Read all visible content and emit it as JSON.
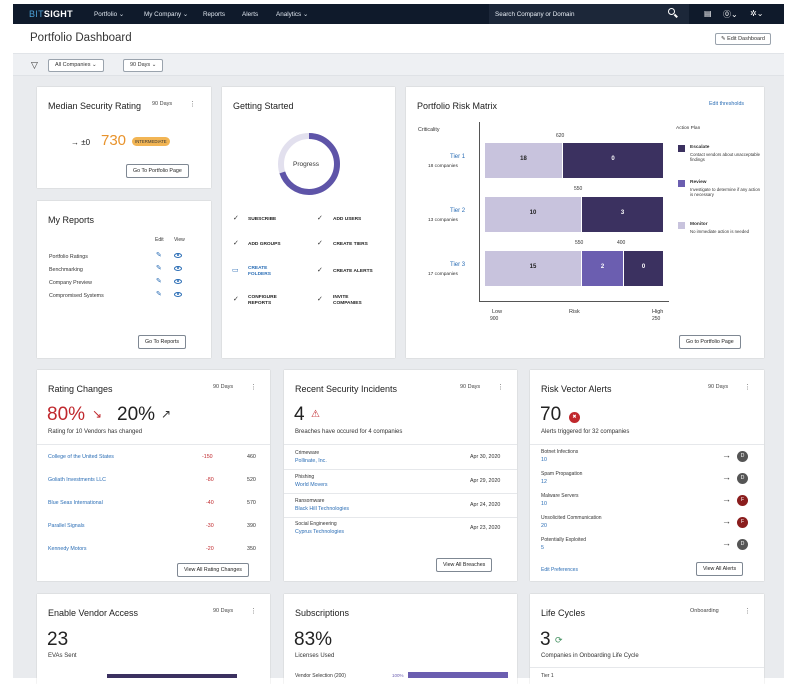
{
  "nav": {
    "logo_a": "BIT",
    "logo_b": "SIGHT",
    "items": [
      "Portfolio ⌄",
      "My Company ⌄",
      "Reports",
      "Alerts",
      "Analytics ⌄"
    ],
    "search": "Search Company or Domain"
  },
  "header": {
    "title": "Portfolio Dashboard",
    "edit": "Edit Dashboard"
  },
  "filters": {
    "companies": "All Companies ⌄",
    "days": "90 Days ⌄"
  },
  "median": {
    "title": "Median Security Rating",
    "days": "90 Days",
    "delta": "→ ±0",
    "value": "730",
    "badge": "INTERMEDIATE",
    "button": "Go To Portfolio Page"
  },
  "reports": {
    "title": "My Reports",
    "edit": "Edit",
    "view": "View",
    "items": [
      "Portfolio Ratings",
      "Benchmarking",
      "Company Preview",
      "Compromised Systems"
    ],
    "button": "Go To Reports"
  },
  "getting": {
    "title": "Getting Started",
    "progress": "Progress",
    "progress_pct": 70,
    "items": [
      [
        "SUBSCRIBE",
        "ADD USERS"
      ],
      [
        "ADD GROUPS",
        "CREATE TIERS"
      ],
      [
        "CREATE FOLDERS",
        "CREATE ALERTS"
      ],
      [
        "CONFIGURE REPORTS",
        "INVITE COMPANIES"
      ]
    ]
  },
  "risk": {
    "title": "Portfolio Risk Matrix",
    "edit": "Edit thresholds",
    "criticality": "Criticality",
    "action_plan": "Action Plan",
    "tiers": [
      {
        "name": "Tier 1",
        "sub": "18 companies"
      },
      {
        "name": "Tier 2",
        "sub": "13 companies"
      },
      {
        "name": "Tier 3",
        "sub": "17 companies"
      }
    ],
    "thresholds": [
      "620",
      "550",
      "550",
      "400"
    ],
    "low": "Low",
    "low_val": "900",
    "risk": "Risk",
    "high": "High",
    "high_val": "250",
    "legend": [
      {
        "t": "Escalate",
        "d": "Contact vendors about unacceptable findings"
      },
      {
        "t": "Review",
        "d": "Investigate to determine if any action is necessary"
      },
      {
        "t": "Monitor",
        "d": "No immediate action is needed"
      }
    ],
    "button": "Go to Portfolio Page"
  },
  "chart_data": {
    "type": "bar",
    "categories": [
      "Tier 1",
      "Tier 2",
      "Tier 3"
    ],
    "series": [
      {
        "name": "Monitor",
        "values": [
          18,
          10,
          15
        ]
      },
      {
        "name": "Review",
        "values": [
          0,
          0,
          2
        ]
      },
      {
        "name": "Escalate",
        "values": [
          0,
          3,
          0
        ]
      }
    ]
  },
  "rating_changes": {
    "title": "Rating Changes",
    "days": "90 Days",
    "down": "80%",
    "up": "20%",
    "sub": "Rating for 10 Vendors has changed",
    "rows": [
      [
        "College of the United States",
        "-150",
        "460"
      ],
      [
        "Goliath Investments LLC",
        "-80",
        "520"
      ],
      [
        "Blue Seas International",
        "-40",
        "570"
      ],
      [
        "Parallel Signals",
        "-30",
        "390"
      ],
      [
        "Kennedy Motors",
        "-20",
        "350"
      ]
    ],
    "button": "View All Rating Changes"
  },
  "incidents": {
    "title": "Recent Security Incidents",
    "days": "90 Days",
    "count": "4",
    "sub": "Breaches have occured for 4 companies",
    "rows": [
      [
        "Crimeware",
        "Pollinate, Inc.",
        "Apr 30, 2020"
      ],
      [
        "Phishing",
        "World Movers",
        "Apr 29, 2020"
      ],
      [
        "Ransomware",
        "Black Hill Technologies",
        "Apr 24, 2020"
      ],
      [
        "Social Engineering",
        "Cyprus Technologies",
        "Apr 23, 2020"
      ]
    ],
    "button": "View All Breaches"
  },
  "alerts": {
    "title": "Risk Vector Alerts",
    "days": "90 Days",
    "count": "70",
    "sub": "Alerts triggered for 32 companies",
    "rows": [
      [
        "Botnet Infections",
        "10",
        "D"
      ],
      [
        "Spam Propagation",
        "12",
        "D"
      ],
      [
        "Malware Servers",
        "10",
        "F"
      ],
      [
        "Unsolicited Communication",
        "20",
        "F"
      ],
      [
        "Potentially Exploited",
        "5",
        "D"
      ]
    ],
    "edit": "Edit Preferences",
    "button": "View All Alerts"
  },
  "vendor": {
    "title": "Enable Vendor Access",
    "days": "90 Days",
    "count": "23",
    "sub": "EVAs Sent"
  },
  "subs": {
    "title": "Subscriptions",
    "pct": "83%",
    "sub": "Licenses Used",
    "row": "Vendor Selection (200)",
    "row_pct": "100%"
  },
  "life": {
    "title": "Life Cycles",
    "mode": "Onboarding",
    "count": "3",
    "sub": "Companies in Onboarding Life Cycle",
    "row": "Tier 1"
  }
}
